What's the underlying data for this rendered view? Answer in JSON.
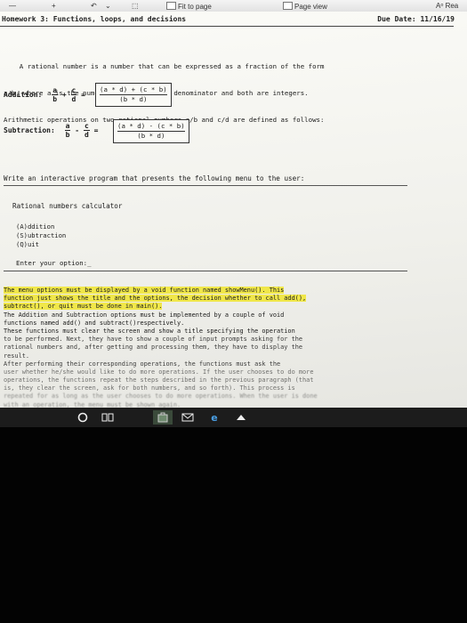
{
  "ribbon": {
    "fit_to_page": "Fit to page",
    "page_view": "Page view",
    "read_aloud": "Rea"
  },
  "document": {
    "header_title": "Homework 3: Functions, loops, and decisions",
    "due_date": "Due Date: 11/16/19",
    "intro_lines": [
      "    A rational number is a number that can be expressed as a fraction of the form",
      "a/b, where a is the numerator and b is the denominator and both are integers.",
      "Arithmetic operations on two rational numbers a/b and c/d are defined as follows:"
    ],
    "addition": {
      "label": "Addition:",
      "lhs_num": "a",
      "lhs_op": "+",
      "rhs_num": "c",
      "lhs_den": "b",
      "rhs_den": "d",
      "eq": "=",
      "box_num": "(a * d) + (c * b)",
      "box_den": "(b * d)"
    },
    "subtraction": {
      "label": "Subtraction:",
      "lhs_num": "a",
      "lhs_op": "-",
      "rhs_num": "c",
      "lhs_den": "b",
      "rhs_den": "d",
      "eq": "=",
      "box_num": "(a * d) - (c * b)",
      "box_den": "(b * d)"
    },
    "sentence": "Write an interactive program that presents the following menu to the user:",
    "menu_title": "Rational numbers calculator",
    "menu_items": [
      "(A)ddition",
      "(S)ubtraction",
      "(Q)uit"
    ],
    "prompt": "Enter your option:_",
    "spec_lines": [
      {
        "text": "     The menu options must be displayed by a void function named showMenu(). This",
        "hl": true
      },
      {
        "text": "function just shows the title and the options, the decision whether to call add(),",
        "hl": true
      },
      {
        "text": "subtract(), or quit must be done in main().",
        "hl": true
      },
      {
        "text": "     The Addition and Subtraction options must be implemented by a couple of void",
        "hl": false
      },
      {
        "text": "functions named add() and subtract()respectively.",
        "hl": false
      },
      {
        "text": "     These functions must clear the screen and show a title specifying the operation",
        "hl": false
      },
      {
        "text": "to be performed. Next, they have to show a couple of input prompts asking for the",
        "hl": false
      },
      {
        "text": "rational numbers and, after getting and processing them, they have to display the",
        "hl": false
      },
      {
        "text": "result.",
        "hl": false
      },
      {
        "text": "     After performing their corresponding operations, the functions must ask the",
        "hl": false
      },
      {
        "text": "user whether he/she would like to do more operations. If the user chooses to do more",
        "hl": false
      },
      {
        "text": "operations, the functions repeat the steps described in the previous paragraph (that",
        "hl": false
      },
      {
        "text": "is, they clear the screen, ask for both numbers, and so forth). This process is",
        "hl": false
      },
      {
        "text": "repeated for as long as the user chooses to do more operations. When the user is done",
        "hl": false
      },
      {
        "text": "with an operation, the menu must be shown again.",
        "hl": false
      }
    ]
  },
  "taskbar": {
    "items": [
      "start-icon",
      "cortana-icon",
      "task-view-icon",
      "store-icon",
      "mail-icon",
      "edge-icon"
    ]
  },
  "colors": {
    "highlight": "#f0e74a",
    "page_bg": "#f6f6f1",
    "taskbar_bg": "#1c1c1c"
  }
}
